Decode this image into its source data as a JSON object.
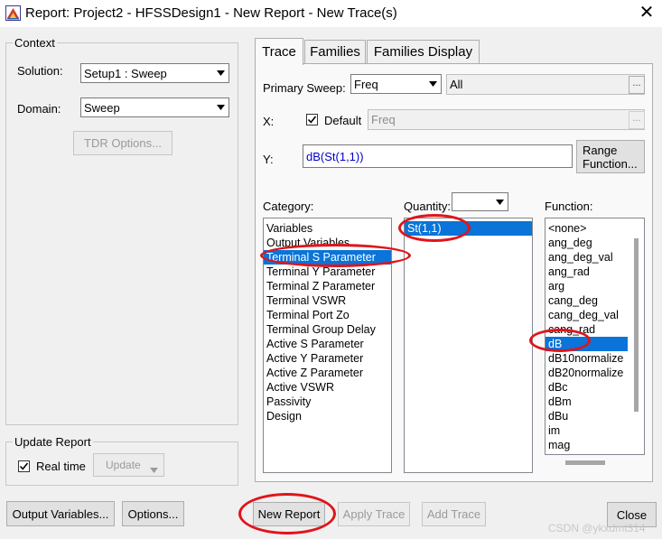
{
  "window": {
    "title": "Report: Project2 - HFSSDesign1 - New Report - New Trace(s)",
    "close_glyph": "✕"
  },
  "context": {
    "legend": "Context",
    "solution_label": "Solution:",
    "solution_value": "Setup1 : Sweep",
    "domain_label": "Domain:",
    "domain_value": "Sweep",
    "tdr_button": "TDR Options..."
  },
  "update_report": {
    "legend": "Update Report",
    "realtime_label": "Real time",
    "realtime_checked": true,
    "update_button": "Update"
  },
  "tabs": [
    {
      "label": "Trace",
      "active": true
    },
    {
      "label": "Families",
      "active": false
    },
    {
      "label": "Families Display",
      "active": false
    }
  ],
  "trace": {
    "primary_sweep_label": "Primary Sweep:",
    "primary_sweep_value": "Freq",
    "primary_sweep_range": "All",
    "ellipsis": "...",
    "x_label": "X:",
    "default_label": "Default",
    "default_checked": true,
    "x_value": "Freq",
    "y_label": "Y:",
    "y_value": "dB(St(1,1))",
    "range_function_line1": "Range",
    "range_function_line2": "Function...",
    "category_label": "Category:",
    "quantity_label": "Quantity:",
    "quantity_filter": "",
    "function_label": "Function:",
    "categories": [
      "Variables",
      "Output Variables",
      "Terminal S Parameter",
      "Terminal Y Parameter",
      "Terminal Z Parameter",
      "Terminal VSWR",
      "Terminal Port Zo",
      "Terminal Group Delay",
      "Active S Parameter",
      "Active Y Parameter",
      "Active Z Parameter",
      "Active VSWR",
      "Passivity",
      "Design"
    ],
    "selected_category": "Terminal S Parameter",
    "quantities": [
      "St(1,1)"
    ],
    "selected_quantity": "St(1,1)",
    "functions": [
      "<none>",
      "ang_deg",
      "ang_deg_val",
      "ang_rad",
      "arg",
      "cang_deg",
      "cang_deg_val",
      "cang_rad",
      "dB",
      "dB10normalize",
      "dB20normalize",
      "dBc",
      "dBm",
      "dBu",
      "im",
      "mag"
    ],
    "selected_function": "dB"
  },
  "footer": {
    "output_variables": "Output Variables...",
    "options": "Options...",
    "new_report": "New Report",
    "apply_trace": "Apply Trace",
    "add_trace": "Add Trace",
    "close": "Close"
  },
  "watermark": "CSDN @ykxdmt314",
  "colors": {
    "selection": "#0a74d8",
    "annotation": "#e0141c",
    "y_expression": "#0000cc"
  }
}
